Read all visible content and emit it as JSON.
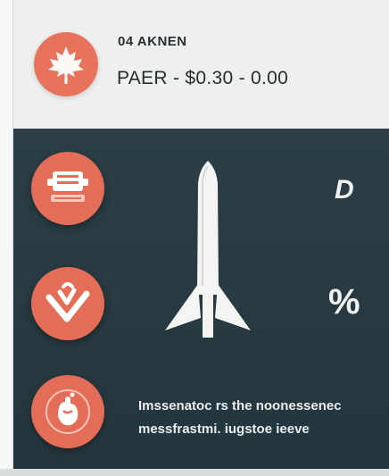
{
  "header": {
    "title": "04 AKNEN",
    "subtitle": "PAER - $0.30 - 0.00",
    "badge_icon": "maple-leaf-icon",
    "badge_color": "#e8735c"
  },
  "panel": {
    "background": "#283a42",
    "buttons": [
      {
        "icon": "badge-icon",
        "label": "button-1"
      },
      {
        "icon": "check-chevron-icon",
        "label": "button-2"
      },
      {
        "icon": "hand-icon",
        "label": "button-3"
      }
    ],
    "center_icon": "rocket-icon",
    "right_glyph_top": "D",
    "right_glyph_mid": "%",
    "caption_line_1": "Imssenatoc rs the noonessenec",
    "caption_line_2": "messfrastmi. iugstoe ieeve"
  }
}
